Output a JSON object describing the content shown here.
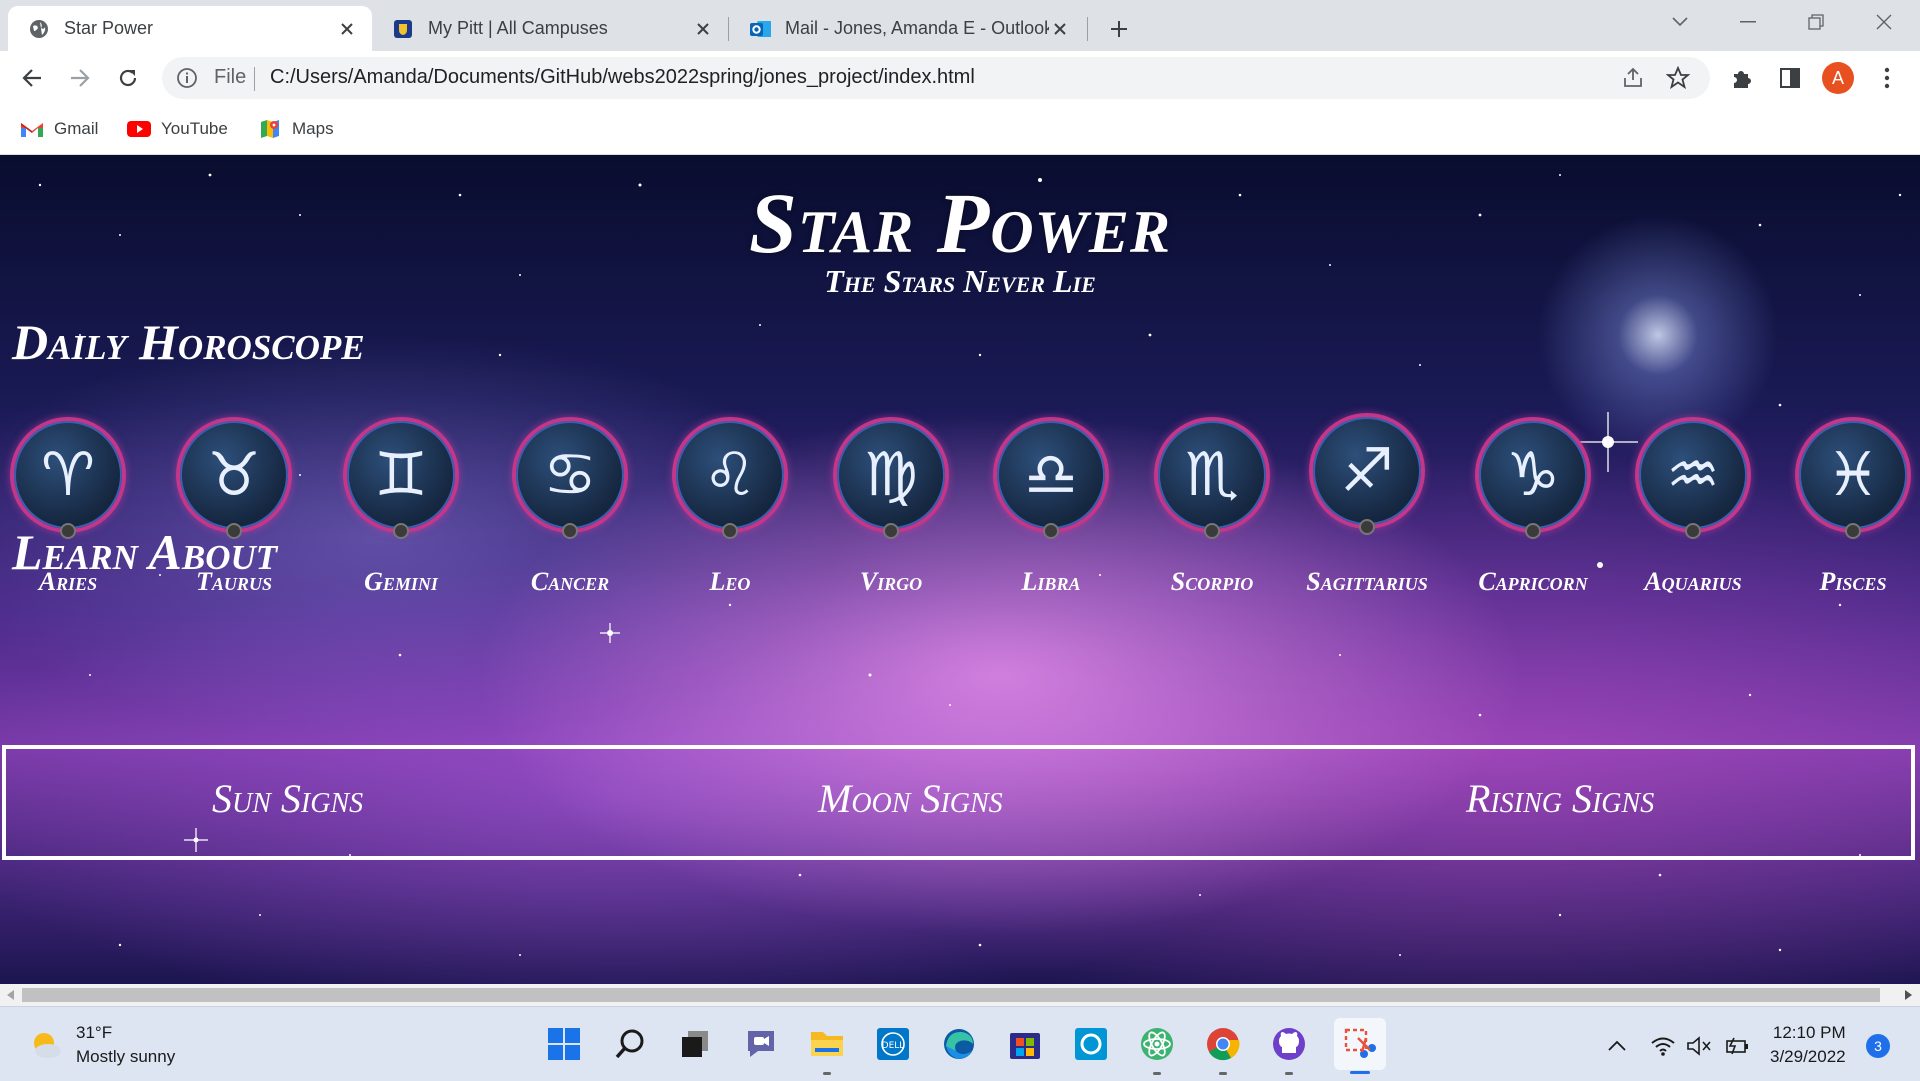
{
  "browser": {
    "tabs": [
      {
        "title": "Star Power",
        "favicon": "globe-icon"
      },
      {
        "title": "My Pitt | All Campuses",
        "favicon": "pitt-shield-icon"
      },
      {
        "title": "Mail - Jones, Amanda E - Outlook",
        "favicon": "outlook-icon"
      }
    ],
    "omnibox": {
      "scheme_label": "File",
      "url": "C:/Users/Amanda/Documents/GitHub/webs2022spring/jones_project/index.html"
    },
    "profile_initial": "A",
    "bookmarks": [
      {
        "label": "Gmail",
        "icon": "gmail-icon"
      },
      {
        "label": "YouTube",
        "icon": "youtube-icon"
      },
      {
        "label": "Maps",
        "icon": "maps-icon"
      }
    ]
  },
  "page": {
    "title": "Star Power",
    "subtitle": "The Stars Never Lie",
    "daily_heading": "Daily Horoscope",
    "signs": [
      {
        "name": "Aries",
        "glyph": "♈"
      },
      {
        "name": "Taurus",
        "glyph": "♉"
      },
      {
        "name": "Gemini",
        "glyph": "♊"
      },
      {
        "name": "Cancer",
        "glyph": "♋"
      },
      {
        "name": "Leo",
        "glyph": "♌"
      },
      {
        "name": "Virgo",
        "glyph": "♍"
      },
      {
        "name": "Libra",
        "glyph": "♎"
      },
      {
        "name": "Scorpio",
        "glyph": "♏"
      },
      {
        "name": "Sagittarius",
        "glyph": "♐"
      },
      {
        "name": "Capricorn",
        "glyph": "♑"
      },
      {
        "name": "Aquarius",
        "glyph": "♒"
      },
      {
        "name": "Pisces",
        "glyph": "♓"
      }
    ],
    "learn_heading": "Learn About",
    "learn_items": [
      "Sun Signs",
      "Moon Signs",
      "Rising Signs"
    ]
  },
  "taskbar": {
    "weather": {
      "temp": "31°F",
      "condition": "Mostly sunny"
    },
    "apps": [
      "start-icon",
      "search-icon",
      "task-view-icon",
      "teams-chat-icon",
      "file-explorer-icon",
      "dell-icon",
      "edge-icon",
      "store-icon",
      "cortana-icon",
      "atom-icon",
      "chrome-icon",
      "github-desktop-icon",
      "snipping-tool-icon"
    ],
    "clock": {
      "time": "12:10 PM",
      "date": "3/29/2022"
    },
    "notification_count": "3"
  },
  "colors": {
    "sign_ring": "#c4368a",
    "text": "#ffffff",
    "accent": "#1f6feb"
  }
}
